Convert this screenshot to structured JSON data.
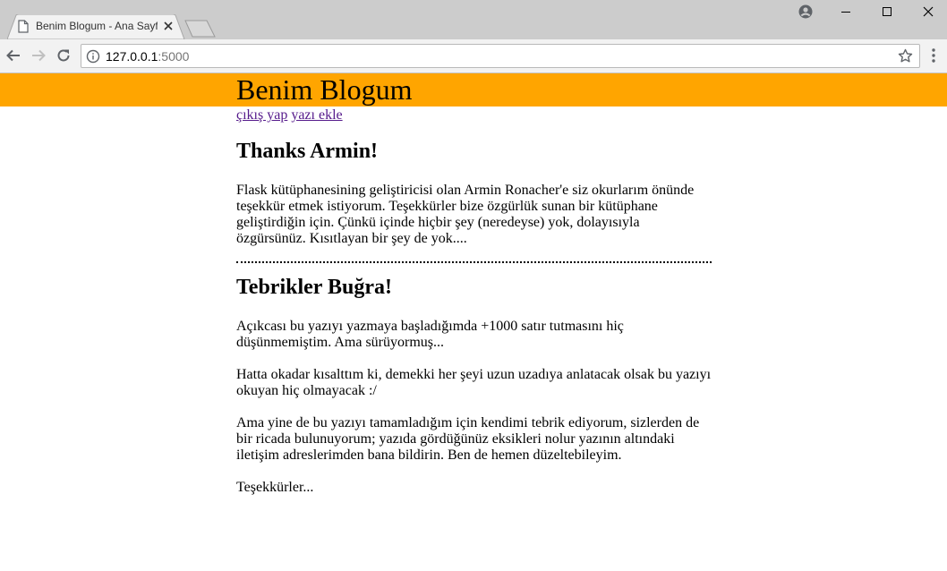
{
  "browser": {
    "tab_title": "Benim Blogum - Ana Sayfa",
    "url_host": "127.0.0.1",
    "url_port": ":5000"
  },
  "site": {
    "title": "Benim Blogum",
    "banner_color": "#ffa500",
    "nav": [
      {
        "label": "çıkış yap"
      },
      {
        "label": "yazı ekle"
      }
    ]
  },
  "posts": [
    {
      "title": "Thanks Armin!",
      "paragraphs": [
        "Flask kütüphanesining geliştiricisi olan Armin Ronacher'e siz okurlarım önünde teşekkür etmek istiyorum. Teşekkürler bize özgürlük sunan bir kütüphane geliştirdiğin için. Çünkü içinde hiçbir şey (neredeyse) yok, dolayısıyla özgürsünüz. Kısıtlayan bir şey de yok...."
      ]
    },
    {
      "title": "Tebrikler Buğra!",
      "paragraphs": [
        "Açıkcası bu yazıyı yazmaya başladığımda +1000 satır tutmasını hiç düşünmemiştim. Ama sürüyormuş...",
        "Hatta okadar kısalttım ki, demekki her şeyi uzun uzadıya anlatacak olsak bu yazıyı okuyan hiç olmayacak :/",
        "Ama yine de bu yazıyı tamamladığım için kendimi tebrik ediyorum, sizlerden de bir ricada bulunuyorum; yazıda gördüğünüz eksikleri nolur yazının altındaki iletişim adreslerimden bana bildirin. Ben de hemen düzeltebileyim.",
        "Teşekkürler..."
      ]
    }
  ]
}
